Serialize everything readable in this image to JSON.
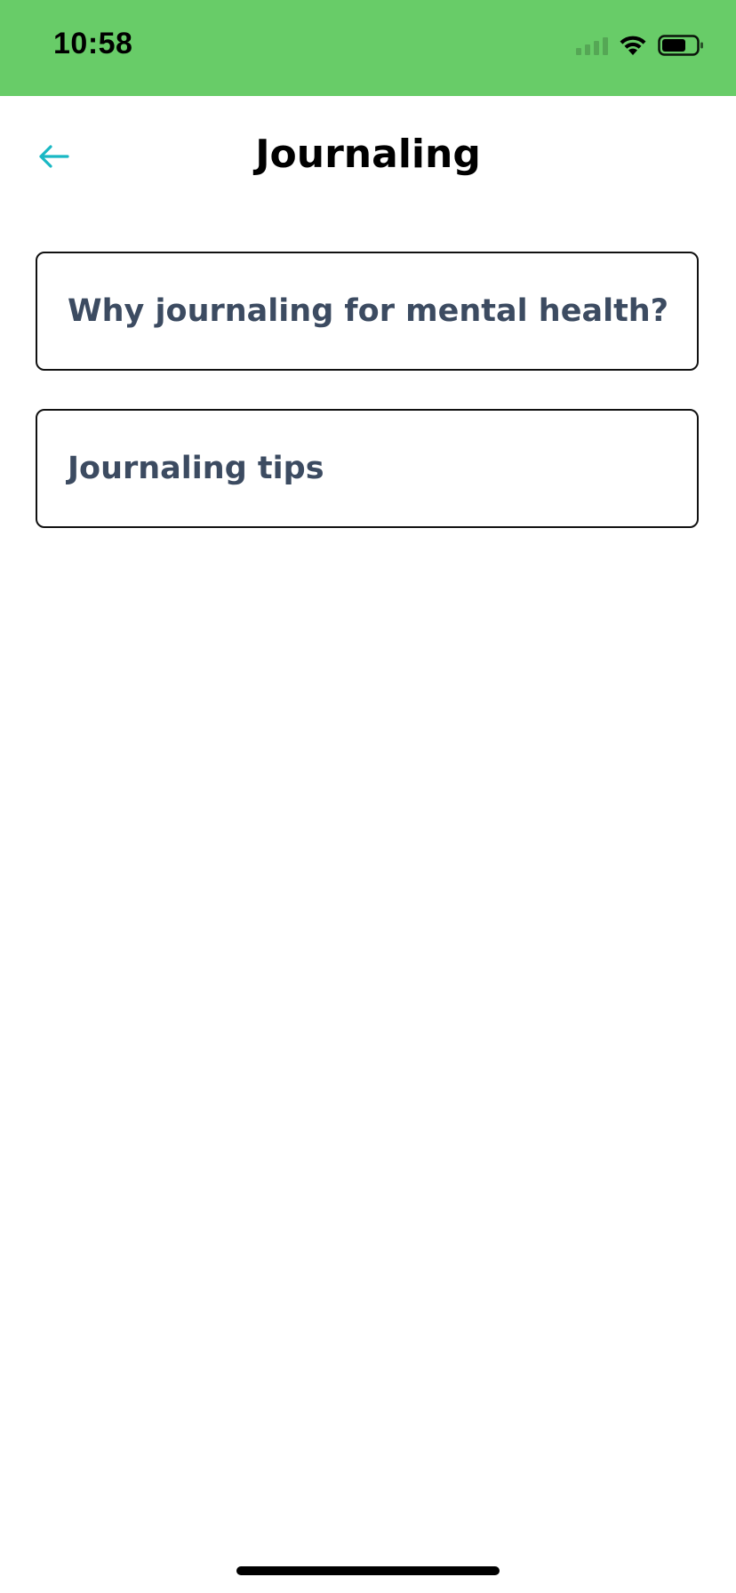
{
  "status_bar": {
    "time": "10:58",
    "background_color": "#68cc68",
    "icons": [
      "cellular-signal-icon",
      "wifi-icon",
      "battery-icon"
    ]
  },
  "header": {
    "title": "Journaling",
    "back_icon": "arrow-left-icon",
    "accent_color": "#19b8c4"
  },
  "items": [
    {
      "label": "Why journaling for mental health?"
    },
    {
      "label": "Journaling tips"
    }
  ],
  "colors": {
    "card_text": "#3c4b61",
    "card_border": "#111111"
  }
}
